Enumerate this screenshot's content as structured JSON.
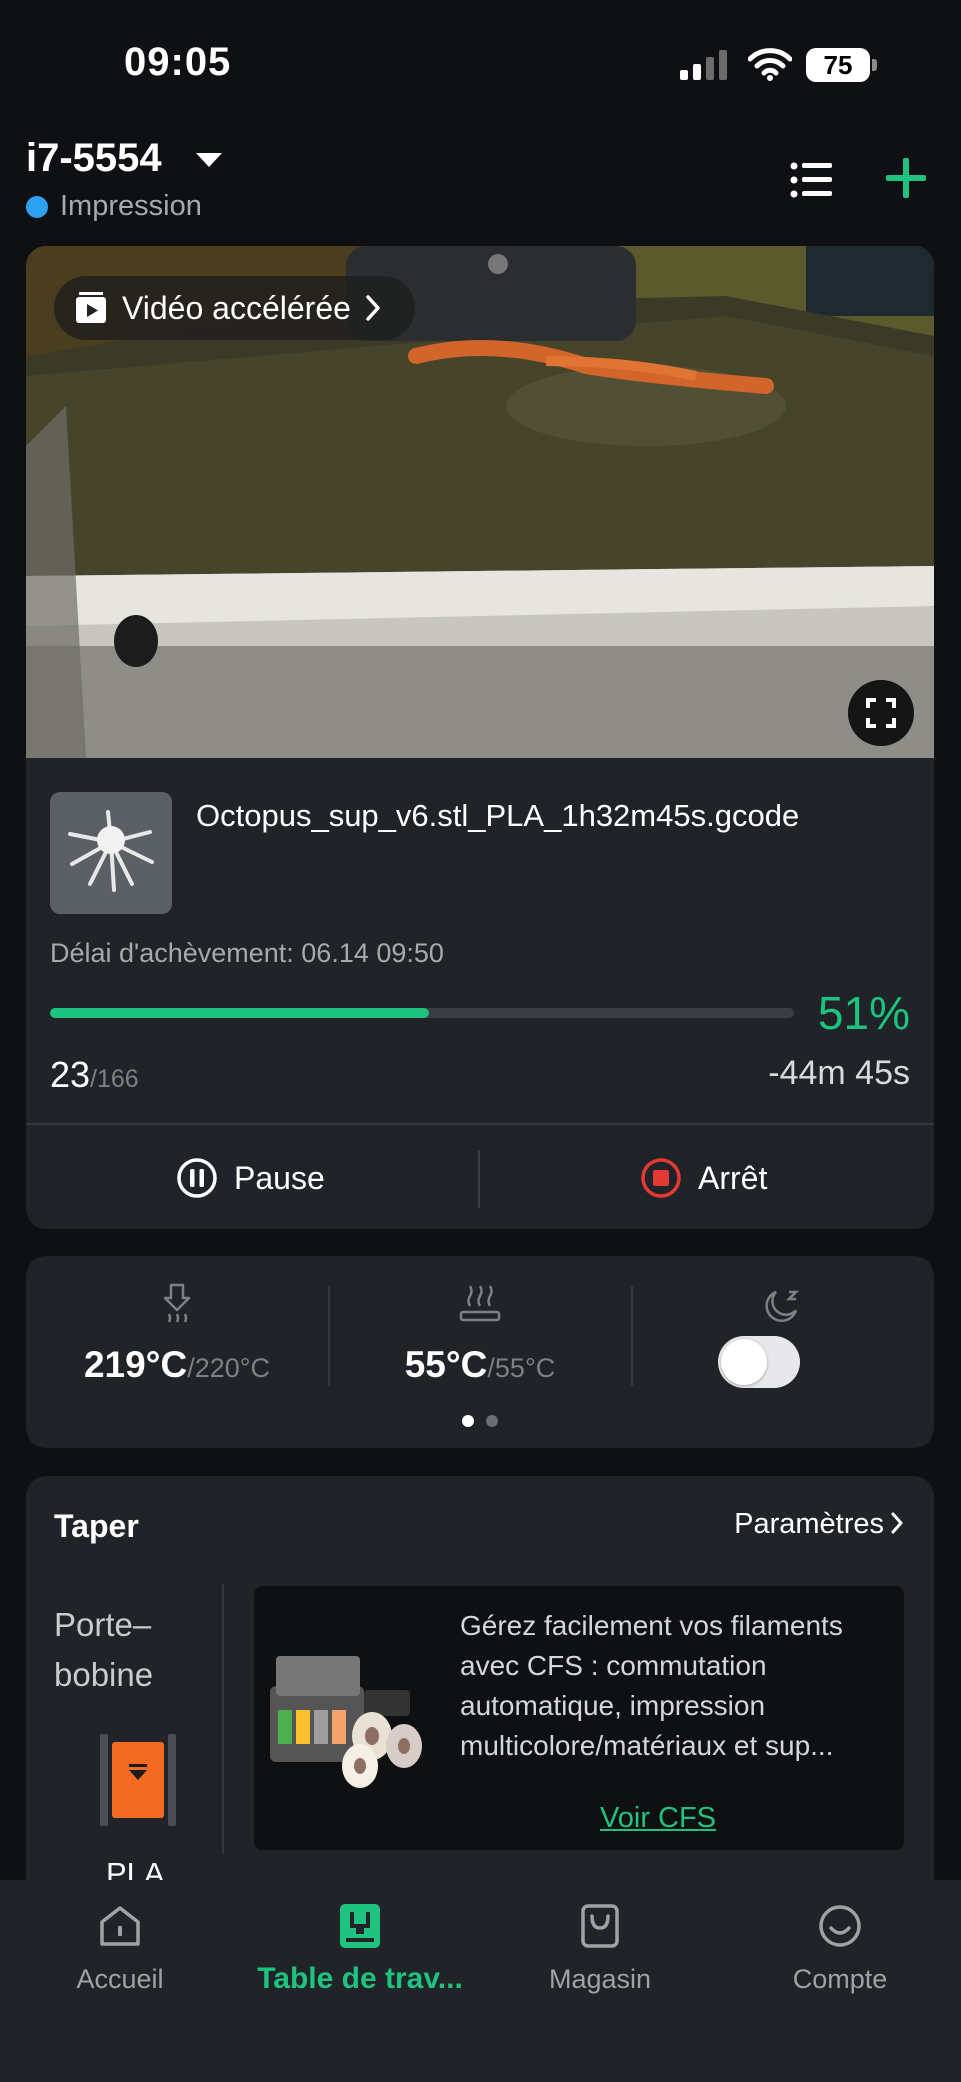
{
  "status_bar": {
    "time": "09:05",
    "battery": "75"
  },
  "header": {
    "printer_name": "i7-5554",
    "status": "Impression"
  },
  "camera": {
    "timelapse_label": "Vidéo accélérée"
  },
  "job": {
    "filename": "Octopus_sup_v6.stl_PLA_1h32m45s.gcode",
    "eta": "Délai d'achèvement: 06.14 09:50",
    "progress_percent": 51,
    "progress_label": "51%",
    "layer_current": "23",
    "layer_total": "/166",
    "remaining": "-44m 45s",
    "pause_label": "Pause",
    "stop_label": "Arrêt"
  },
  "temps": {
    "nozzle_current": "219°C",
    "nozzle_target": "/220°C",
    "bed_current": "55°C",
    "bed_target": "/55°C",
    "night_mode_on": false
  },
  "filament": {
    "title": "Taper",
    "settings_label": "Paramètres",
    "spool_label": "Porte–bobine",
    "spool_material": "PLA",
    "spool_color": "#f26b21",
    "promo_text": "Gérez facilement vos filaments avec CFS : commutation automatique, impression multicolore/matériaux et sup...",
    "promo_link": "Voir CFS"
  },
  "tabs": [
    {
      "label": "Accueil",
      "icon": "home-icon"
    },
    {
      "label": "Table de trav...",
      "icon": "workbench-icon",
      "active": true
    },
    {
      "label": "Magasin",
      "icon": "shop-icon"
    },
    {
      "label": "Compte",
      "icon": "account-icon"
    }
  ],
  "colors": {
    "accent": "#1dc37e",
    "status_printing": "#2ea1f2",
    "stop": "#e53935"
  }
}
